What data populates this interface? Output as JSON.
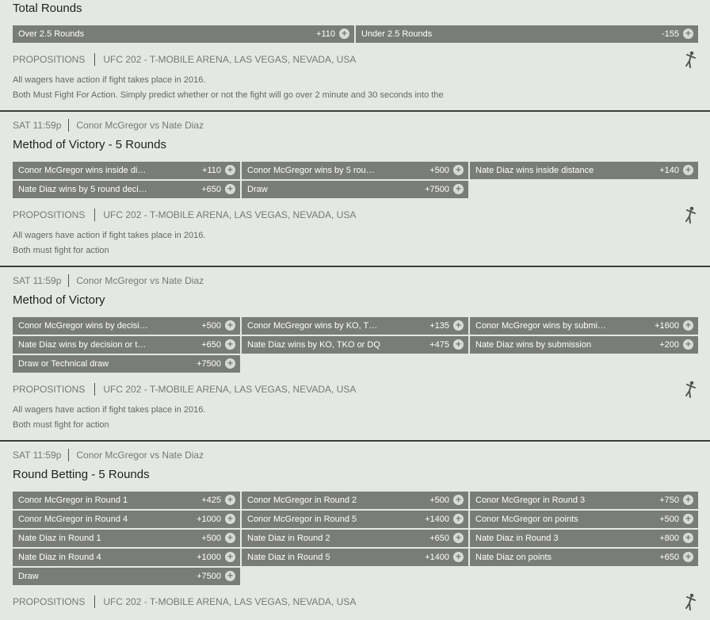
{
  "proposition_label": "PROPOSITIONS",
  "event_location": "UFC 202 - T-MOBILE ARENA, LAS VEGAS, NEVADA, USA",
  "total_rounds": {
    "title": "Total Rounds",
    "buttons": [
      {
        "label": "Over 2.5 Rounds",
        "odds": "+110"
      },
      {
        "label": "Under 2.5 Rounds",
        "odds": "-155"
      }
    ],
    "notes": [
      "All wagers have action if fight takes place in 2016.",
      "Both Must Fight For Action. Simply predict whether or not the fight will go over 2 minute and 30 seconds into the"
    ]
  },
  "method_5": {
    "time": "SAT 11:59p",
    "matchup": "Conor McGregor vs Nate Diaz",
    "title": "Method of Victory - 5 Rounds",
    "buttons": [
      {
        "label": "Conor McGregor wins inside di…",
        "odds": "+110"
      },
      {
        "label": "Conor McGregor wins by 5 rou…",
        "odds": "+500"
      },
      {
        "label": "Nate Diaz wins inside distance",
        "odds": "+140"
      },
      {
        "label": "Nate Diaz wins by 5 round deci…",
        "odds": "+650"
      },
      {
        "label": "Draw",
        "odds": "+7500"
      }
    ],
    "notes": [
      "All wagers have action if fight takes place in 2016.",
      "Both must fight for action"
    ]
  },
  "method": {
    "time": "SAT 11:59p",
    "matchup": "Conor McGregor vs Nate Diaz",
    "title": "Method of Victory",
    "buttons": [
      {
        "label": "Conor McGregor wins by decisi…",
        "odds": "+500"
      },
      {
        "label": "Conor McGregor wins by KO, T…",
        "odds": "+135"
      },
      {
        "label": "Conor McGregor wins by submi…",
        "odds": "+1600"
      },
      {
        "label": "Nate Diaz wins by decision or t…",
        "odds": "+650"
      },
      {
        "label": "Nate Diaz wins by KO, TKO or DQ",
        "odds": "+475"
      },
      {
        "label": "Nate Diaz wins by submission",
        "odds": "+200"
      },
      {
        "label": "Draw or Technical draw",
        "odds": "+7500"
      }
    ],
    "notes": [
      "All wagers have action if fight takes place in 2016.",
      "Both must fight for action"
    ]
  },
  "round_betting": {
    "time": "SAT 11:59p",
    "matchup": "Conor McGregor vs Nate Diaz",
    "title": "Round Betting - 5 Rounds",
    "buttons": [
      {
        "label": "Conor McGregor in Round 1",
        "odds": "+425"
      },
      {
        "label": "Conor McGregor in Round 2",
        "odds": "+500"
      },
      {
        "label": "Conor McGregor in Round 3",
        "odds": "+750"
      },
      {
        "label": "Conor McGregor in Round 4",
        "odds": "+1000"
      },
      {
        "label": "Conor McGregor in Round 5",
        "odds": "+1400"
      },
      {
        "label": "Conor McGregor on points",
        "odds": "+500"
      },
      {
        "label": "Nate Diaz in Round 1",
        "odds": "+500"
      },
      {
        "label": "Nate Diaz in Round 2",
        "odds": "+650"
      },
      {
        "label": "Nate Diaz in Round 3",
        "odds": "+800"
      },
      {
        "label": "Nate Diaz in Round 4",
        "odds": "+1000"
      },
      {
        "label": "Nate Diaz in Round 5",
        "odds": "+1400"
      },
      {
        "label": "Nate Diaz on points",
        "odds": "+650"
      },
      {
        "label": "Draw",
        "odds": "+7500"
      }
    ]
  },
  "icons": {
    "add": "plus-circle-icon",
    "sport": "fighter-icon"
  },
  "colors": {
    "background": "#e3e9e2",
    "button": "#7a7d77",
    "separator": "#3c3c3c"
  }
}
